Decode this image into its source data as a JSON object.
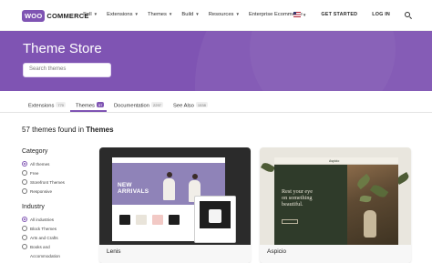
{
  "brand": {
    "woo": "WOO",
    "commerce": "COMMERCE",
    "accent": "#7f54b3"
  },
  "nav": {
    "items": [
      {
        "label": "Sell",
        "has_menu": true
      },
      {
        "label": "Extensions",
        "has_menu": true
      },
      {
        "label": "Themes",
        "has_menu": true
      },
      {
        "label": "Build",
        "has_menu": true
      },
      {
        "label": "Resources",
        "has_menu": true
      },
      {
        "label": "Enterprise Ecommerce",
        "has_menu": false
      }
    ],
    "get_started": "GET STARTED",
    "login": "LOG IN",
    "locale_icon": "us-flag-icon",
    "search_icon": "search-icon"
  },
  "hero": {
    "title": "Theme Store",
    "search_placeholder": "Search themes"
  },
  "tabs": [
    {
      "label": "Extensions",
      "count": "770",
      "active": false
    },
    {
      "label": "Themes",
      "count": "57",
      "active": true
    },
    {
      "label": "Documentation",
      "count": "2297",
      "active": false
    },
    {
      "label": "See Also",
      "count": "1538",
      "active": false
    }
  ],
  "results": {
    "prefix": "57 themes found in ",
    "category": "Themes"
  },
  "filters": {
    "category": {
      "heading": "Category",
      "options": [
        {
          "label": "All themes",
          "checked": true
        },
        {
          "label": "Free",
          "checked": false
        },
        {
          "label": "Storefront Themes",
          "checked": false
        },
        {
          "label": "Responsive",
          "checked": false
        }
      ]
    },
    "industry": {
      "heading": "Industry",
      "options": [
        {
          "label": "All industries",
          "checked": true
        },
        {
          "label": "Block Themes",
          "checked": false
        },
        {
          "label": "Arts and Crafts",
          "checked": false
        },
        {
          "label": "Books and",
          "checked": false
        },
        {
          "label": "Accommodation",
          "checked": false
        }
      ]
    }
  },
  "themes": [
    {
      "name": "Lenis",
      "preview_headline_1": "NEW",
      "preview_headline_2": "ARRIVALS"
    },
    {
      "name": "Aspicio",
      "preview_logo": "Aspicio",
      "preview_tagline_1": "Rest your eye",
      "preview_tagline_2": "on something",
      "preview_tagline_3": "beautiful."
    }
  ]
}
